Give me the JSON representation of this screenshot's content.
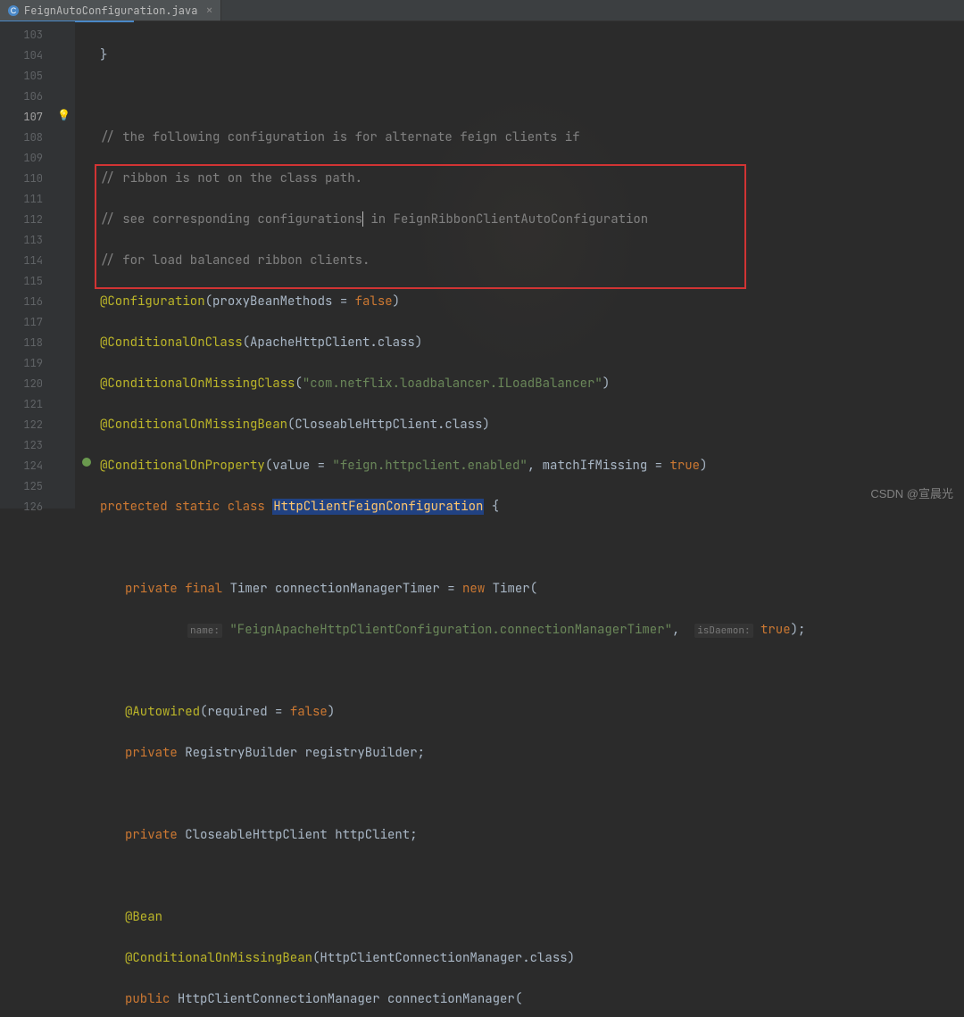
{
  "tab": {
    "filename": "FeignAutoConfiguration.java"
  },
  "gutter": {
    "numbers": [
      "103",
      "104",
      "105",
      "106",
      "107",
      "108",
      "109",
      "110",
      "111",
      "112",
      "113",
      "114",
      "115",
      "116",
      "117",
      "118",
      "119",
      "120",
      "121",
      "122",
      "123",
      "124",
      "125",
      "126"
    ],
    "current_line": "107"
  },
  "code": {
    "l103": "}",
    "l104": "",
    "c105": "// the following configuration is for alternate feign clients if",
    "c106": "// ribbon is not on the class path.",
    "c107a": "// see corresponding configurations",
    "c107b": " in FeignRibbonClientAutoConfiguration",
    "c108": "// for load balanced ribbon clients.",
    "a109_name": "@Configuration",
    "a109_attr": "proxyBeanMethods",
    "a109_val": "false",
    "a110_name": "@ConditionalOnClass",
    "a110_arg": "ApacheHttpClient",
    "a110_sfx": ".class",
    "a111_name": "@ConditionalOnMissingClass",
    "a111_str": "\"com.netflix.loadbalancer.ILoadBalancer\"",
    "a112_name": "@ConditionalOnMissingBean",
    "a112_arg": "CloseableHttpClient",
    "a112_sfx": ".class",
    "a113_name": "@ConditionalOnProperty",
    "a113_k1": "value",
    "a113_v1": "\"feign.httpclient.enabled\"",
    "a113_k2": "matchIfMissing",
    "a113_v2": "true",
    "l114_mods": "protected static class ",
    "l114_class": "HttpClientFeignConfiguration",
    "l114_brace": " {",
    "l116_mods": "private final ",
    "l116_type": "Timer ",
    "l116_name": "connectionManagerTimer",
    "l116_eq": " = ",
    "l116_new": "new ",
    "l116_ctor": "Timer(",
    "l117_h1": "name:",
    "l117_str": " \"FeignApacheHttpClientConfiguration.connectionManagerTimer\"",
    "l117_comma": ",  ",
    "l117_h2": "isDaemon:",
    "l117_val": " true",
    "l117_end": ");",
    "a119_name": "@Autowired",
    "a119_attr": "required",
    "a119_val": "false",
    "l120_mods": "private ",
    "l120_type": "RegistryBuilder ",
    "l120_name": "registryBuilder",
    "l120_end": ";",
    "l122_mods": "private ",
    "l122_type": "CloseableHttpClient ",
    "l122_name": "httpClient",
    "l122_end": ";",
    "a124_name": "@Bean",
    "a125_name": "@ConditionalOnMissingBean",
    "a125_arg": "HttpClientConnectionManager",
    "a125_sfx": ".class",
    "l126_mods": "public ",
    "l126_type": "HttpClientConnectionManager ",
    "l126_name": "connectionManager",
    "l126_end": "("
  },
  "watermark": "CSDN @宣晨光"
}
